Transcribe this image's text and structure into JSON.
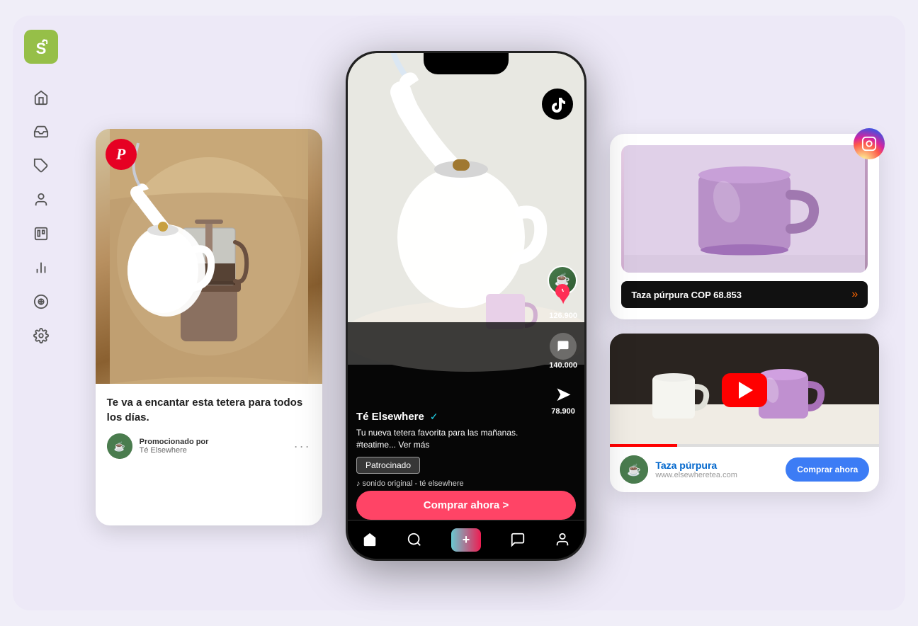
{
  "app": {
    "background_color": "#ede9f7"
  },
  "sidebar": {
    "logo_alt": "Shopify logo",
    "icons": [
      {
        "name": "home-icon",
        "symbol": "⌂"
      },
      {
        "name": "inbox-icon",
        "symbol": "▣"
      },
      {
        "name": "tags-icon",
        "symbol": "◆"
      },
      {
        "name": "customers-icon",
        "symbol": "●"
      },
      {
        "name": "content-icon",
        "symbol": "▨"
      },
      {
        "name": "analytics-icon",
        "symbol": "▦"
      },
      {
        "name": "marketing-icon",
        "symbol": "⊙"
      },
      {
        "name": "settings-icon",
        "symbol": "✦"
      }
    ]
  },
  "pinterest_card": {
    "title": "Te va a encantar esta tetera para todos los días.",
    "promoted_label": "Promocionado por",
    "brand_name": "Té Elsewhere",
    "logo_symbol": "P"
  },
  "tiktok_card": {
    "username": "Té Elsewhere",
    "verified": true,
    "description": "Tu nueva tetera favorita para las mañanas. #teatime... Ver más",
    "description_hashtag": "#teatime",
    "see_more": "Ver más",
    "sponsored_label": "Patrocinado",
    "sound_text": "♪ sonido original - té elsewhere",
    "buy_button": "Comprar ahora >",
    "likes": "126.900",
    "comments": "140.000",
    "shares": "78.900",
    "logo_symbol": "TT"
  },
  "instagram_card": {
    "product_name": "Taza púrpura",
    "product_price": "COP 68.853",
    "logo_symbol": "ig"
  },
  "youtube_card": {
    "product_title": "Taza púrpura",
    "website": "www.elsewheretea.com",
    "cta_button": "Comprar ahora",
    "logo_symbol": "YT"
  }
}
